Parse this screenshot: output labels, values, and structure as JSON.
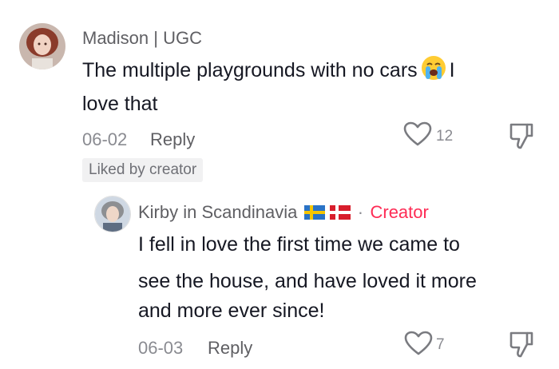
{
  "comment": {
    "username": "Madison | UGC",
    "text_before_emoji": "The multiple playgrounds with no cars",
    "emoji": "crying-face-emoji",
    "text_after_emoji": "I",
    "text_line2": "love that",
    "date": "06-02",
    "reply_label": "Reply",
    "like_count": "12",
    "liked_badge": "Liked by creator"
  },
  "reply": {
    "username": "Kirby in Scandinavia",
    "separator": "·",
    "creator_label": "Creator",
    "text_lines": [
      "I fell in love the first time we came to",
      "see the house, and have loved it more",
      "and more ever since!"
    ],
    "date": "06-03",
    "reply_label": "Reply",
    "like_count": "7"
  },
  "colors": {
    "accent": "#fe2c55",
    "text": "#161823",
    "muted": "#8a8b91"
  },
  "icons": {
    "like": "heart-outline-icon",
    "dislike": "thumbs-down-icon",
    "flags": [
      "sweden-flag-icon",
      "denmark-flag-icon"
    ]
  }
}
